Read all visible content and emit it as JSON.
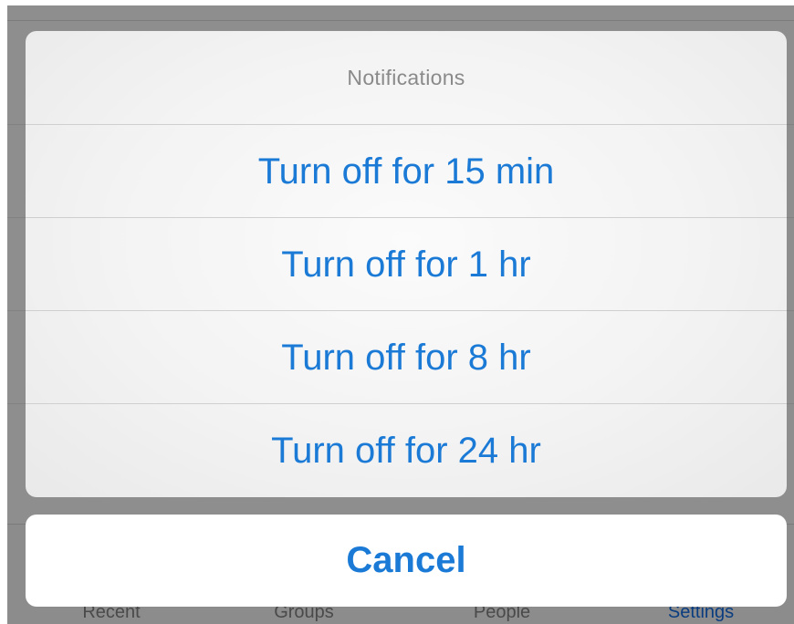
{
  "sheet": {
    "title": "Notifications",
    "options": [
      {
        "label": "Turn off for 15 min"
      },
      {
        "label": "Turn off for 1 hr"
      },
      {
        "label": "Turn off for 8 hr"
      },
      {
        "label": "Turn off for 24 hr"
      }
    ],
    "cancel_label": "Cancel"
  },
  "tabbar": {
    "tabs": [
      {
        "label": "Recent",
        "active": false
      },
      {
        "label": "Groups",
        "active": false
      },
      {
        "label": "People",
        "active": false
      },
      {
        "label": "Settings",
        "active": true
      }
    ]
  },
  "colors": {
    "accent": "#1a7ad6",
    "title_gray": "#8a8a8a",
    "dim_overlay": "#8e8e8e"
  }
}
